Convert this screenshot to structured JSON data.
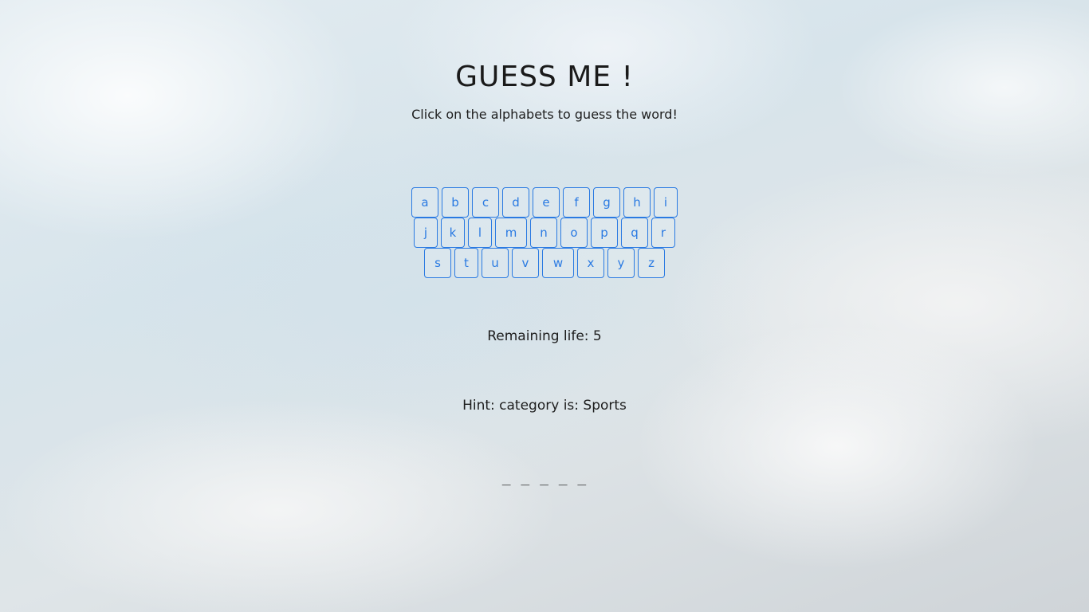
{
  "game": {
    "title": "GUESS ME !",
    "instructions": "Click on the alphabets to guess the word!",
    "remaining_life": "Remaining life: 5",
    "hint": "Hint: category is: Sports",
    "word_display": "_ _ _ _ _"
  },
  "keyboard": {
    "rows": [
      [
        "a",
        "b",
        "c",
        "d",
        "e",
        "f",
        "g",
        "h",
        "i"
      ],
      [
        "j",
        "k",
        "l",
        "m",
        "n",
        "o",
        "p",
        "q",
        "r"
      ],
      [
        "s",
        "t",
        "u",
        "v",
        "w",
        "x",
        "y",
        "z"
      ]
    ]
  },
  "colors": {
    "key_accent": "#2a7ae2",
    "text": "#1d1d1d"
  }
}
